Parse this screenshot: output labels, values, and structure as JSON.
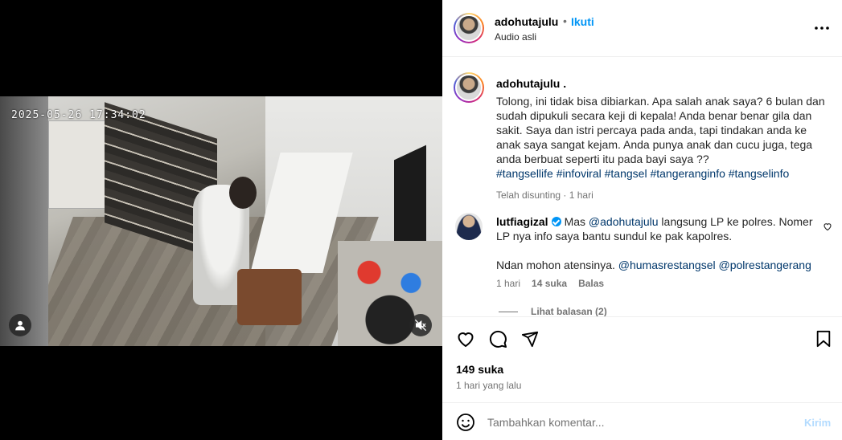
{
  "video": {
    "timestamp": "2025-05-26 17:34:02"
  },
  "header": {
    "username": "adohutajulu",
    "separator": "•",
    "follow_label": "Ikuti",
    "audio_label": "Audio asli"
  },
  "caption": {
    "username": "adohutajulu .",
    "text": "Tolong, ini tidak bisa dibiarkan. Apa salah anak saya? 6 bulan dan sudah dipukuli secara keji di kepala! Anda benar benar gila dan sakit. Saya dan istri percaya pada anda, tapi tindakan anda ke anak saya sangat kejam. Anda punya anak dan cucu juga, tega anda berbuat seperti itu pada bayi saya ??",
    "hashtags": "#tangsellife #infoviral #tangsel #tangeranginfo #tangselinfo",
    "meta": "Telah disunting · 1 hari"
  },
  "comment": {
    "username": "lutfiagizal",
    "text_1a": "Mas ",
    "mention_1": "@adohutajulu",
    "text_1b": " langsung LP ke polres. Nomer LP nya info saya bantu sundul ke pak kapolres.",
    "text_2": "Ndan mohon atensinya. ",
    "mention_2": "@humasrestangsel",
    "mention_3": "@polrestangerang",
    "time": "1 hari",
    "likes": "14 suka",
    "reply_label": "Balas",
    "view_replies": "Lihat balasan (2)"
  },
  "stats": {
    "likes": "149 suka",
    "posted": "1 hari yang lalu"
  },
  "composer": {
    "placeholder": "Tambahkan komentar...",
    "post_label": "Kirim"
  },
  "icons": {
    "video_user": "user-icon",
    "video_mute": "mute-icon",
    "more": "more-icon",
    "like": "heart-icon",
    "comment": "comment-icon",
    "share": "share-icon",
    "save": "bookmark-icon",
    "emoji": "emoji-icon"
  },
  "colors": {
    "accent": "#0095f6",
    "link": "#00376b",
    "muted": "#737373"
  }
}
